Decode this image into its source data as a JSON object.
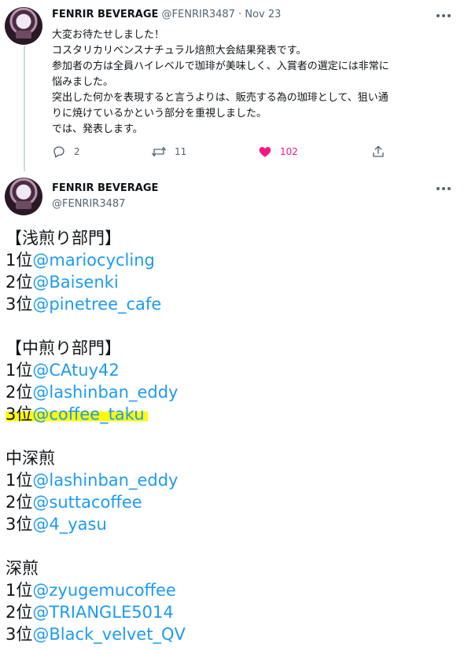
{
  "tweet1": {
    "display_name": "FENRIR BEVERAGE",
    "handle": "@FENRIR3487",
    "separator": "·",
    "date": "Nov 23",
    "lines": [
      "大変お待たせしました！",
      "コスタリカリベンスナチュラル焙煎大会結果発表です。",
      "参加者の方は全員ハイレベルで珈琲が美味しく、入賞者の選定には非常に",
      "悩みました。",
      "突出した何かを表現すると言うよりは、販売する為の珈琲として、狙い通",
      "りに焼けているかという部分を重視しました。",
      "では、発表します。"
    ],
    "reply_count": "2",
    "retweet_count": "11",
    "like_count": "102",
    "like_color": "#f91880"
  },
  "tweet2": {
    "display_name": "FENRIR BEVERAGE",
    "handle": "@FENRIR3487",
    "highlight_color": "#fdfb0a",
    "mention_color": "#1d9bf0",
    "sections": [
      {
        "title": "【浅煎り部門】",
        "entries": [
          {
            "rank": "1位",
            "mention": "@mariocycling"
          },
          {
            "rank": "2位",
            "mention": "@Baisenki"
          },
          {
            "rank": "3位",
            "mention": "@pinetree_cafe"
          }
        ]
      },
      {
        "title": "【中煎り部門】",
        "entries": [
          {
            "rank": "1位",
            "mention": "@CAtuy42"
          },
          {
            "rank": "2位",
            "mention": "@lashinban_eddy"
          },
          {
            "rank": "3位",
            "mention": "@coffee_taku"
          }
        ]
      },
      {
        "title": "中深煎",
        "entries": [
          {
            "rank": "1位",
            "mention": "@lashinban_eddy"
          },
          {
            "rank": "2位",
            "mention": "@suttacoffee"
          },
          {
            "rank": "3位",
            "mention": "@4_yasu"
          }
        ]
      },
      {
        "title": "深煎",
        "entries": [
          {
            "rank": "1位",
            "mention": "@zyugemucoffee"
          },
          {
            "rank": "2位",
            "mention": "@TRIANGLE5014"
          },
          {
            "rank": "3位",
            "mention": "@Black_velvet_QV"
          }
        ]
      }
    ]
  }
}
